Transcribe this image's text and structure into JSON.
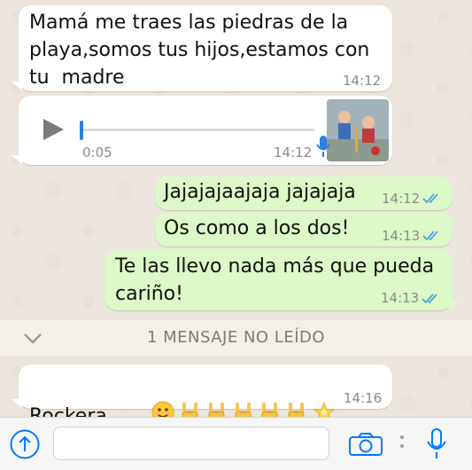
{
  "messages": [
    {
      "direction": "incoming",
      "text": "Mamá me traes las piedras de la\nplaya,somos tus hijos,estamos con\ntu  madre",
      "time": "14:12"
    },
    {
      "direction": "incoming",
      "type": "voice",
      "duration": "0:05",
      "time": "14:12",
      "progress": 0.0
    },
    {
      "direction": "outgoing",
      "text": "Jajajajaajaja jajajaja",
      "time": "14:12",
      "status": "read"
    },
    {
      "direction": "outgoing",
      "text": "Os como a los dos!",
      "time": "14:13",
      "status": "read"
    },
    {
      "direction": "outgoing",
      "text": "Te las llevo nada más que pueda\ncariño!",
      "time": "14:13",
      "status": "read"
    },
    {
      "direction": "incoming",
      "text": "Rockera",
      "time": "14:16",
      "emojis": [
        "smiling-face",
        "sign-of-horns",
        "sign-of-horns",
        "sign-of-horns",
        "sign-of-horns",
        "sign-of-horns",
        "glowing-star"
      ]
    }
  ],
  "unread_divider": "1 MENSAJE NO LEÍDO",
  "input": {
    "value": "",
    "placeholder": ""
  },
  "colors": {
    "incoming": "#ffffff",
    "outgoing": "#dcf8c6",
    "tick_read": "#4fa3e0",
    "accent": "#007aff",
    "background": "#ece5dd"
  },
  "icons": [
    "play-icon",
    "microphone-icon",
    "double-check-icon",
    "chevron-down-icon",
    "upload-icon",
    "camera-icon",
    "more-icon"
  ]
}
